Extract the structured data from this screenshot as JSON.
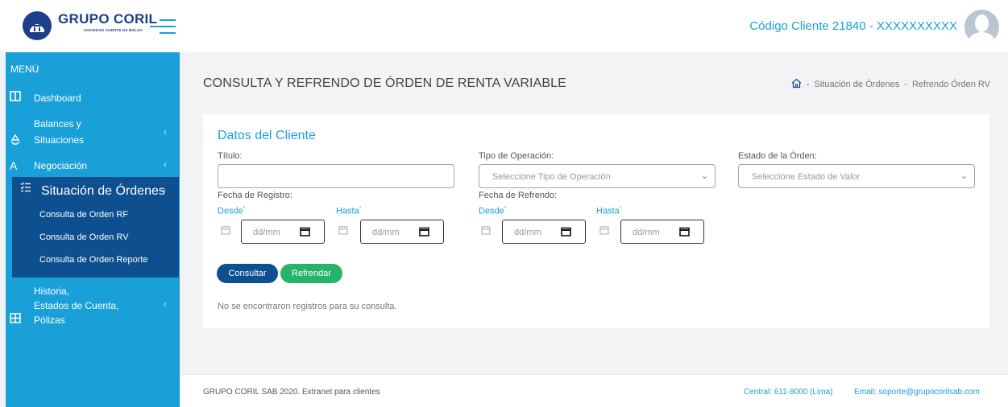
{
  "brand": {
    "name": "GRUPO CORIL",
    "subtitle": "SOCIEDAD AGENTE DE BOLSA"
  },
  "header": {
    "client_code": "Código Cliente 21840 - XXXXXXXXXX"
  },
  "sidebar": {
    "menu_title": "MENÚ",
    "items": [
      {
        "label": "Dashboard",
        "icon": "columns-icon"
      },
      {
        "label_line1": "Balances y",
        "label_line2": "Situaciones",
        "icon": "recycle-icon"
      },
      {
        "label": "Negociación",
        "icon": "letter-a-icon"
      },
      {
        "label": "Situación de Órdenes",
        "icon": "list-check-icon"
      },
      {
        "label_line1": "Historia,",
        "label_line2": "Estados de Cuenta,",
        "label_line3": "Pólizas",
        "icon": "grid-icon"
      }
    ],
    "submenu": [
      {
        "label": "Consulta de Orden RF"
      },
      {
        "label": "Consulta de Orden RV"
      },
      {
        "label": "Consulta de Orden Reporte"
      }
    ]
  },
  "page": {
    "title": "CONSULTA Y REFRENDO DE ÓRDEN DE RENTA VARIABLE",
    "breadcrumb": {
      "sep1": "-",
      "item1": "Situación de Órdenes",
      "sep2": "-",
      "item2": "Refrendo Órden RV"
    }
  },
  "form": {
    "section_title": "Datos del Cliente",
    "titulo_label": "Título:",
    "titulo_value": "",
    "tipo_label": "Tipo de Operación:",
    "tipo_placeholder": "Seleccione Tipo de Operación",
    "estado_label": "Estado de la Órden:",
    "estado_placeholder": "Seleccione Estado de Valor",
    "fecha_registro_label": "Fecha de Registro:",
    "fecha_refrendo_label": "Fecha de Refrendo:",
    "desde": "Desde",
    "hasta": "Hasta",
    "required_mark": "*",
    "date_placeholder": "dd/mm",
    "consultar": "Consultar",
    "refrendar": "Refrendar",
    "no_records": "No se encontraron registros para su consulta."
  },
  "footer": {
    "left": "GRUPO CORIL SAB 2020. Extranet para clientes",
    "central": "Central: 611-8000 (Lima)",
    "email": "Email: soporte@grupocorilsab.com"
  },
  "colors": {
    "primary": "#1aa0d8",
    "dark_blue": "#0e4f8f",
    "green": "#27b36b",
    "brand_navy": "#1c3f8c"
  }
}
